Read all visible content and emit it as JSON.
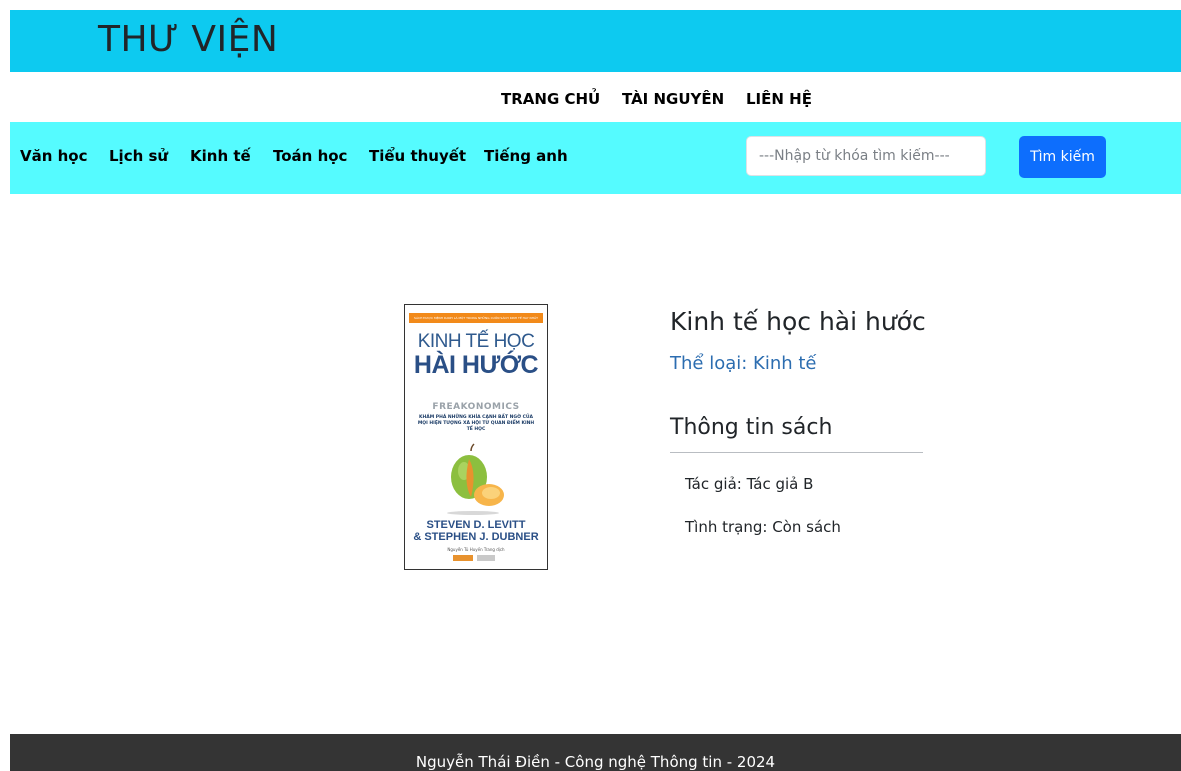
{
  "header": {
    "title": "THƯ VIỆN"
  },
  "topnav": {
    "home": "TRANG CHỦ",
    "resources": "TÀI NGUYÊN",
    "contact": "LIÊN HỆ"
  },
  "categories": [
    "Văn học",
    "Lịch sử",
    "Kinh tế",
    "Toán học",
    "Tiểu thuyết",
    "Tiếng anh"
  ],
  "search": {
    "placeholder": "---Nhập từ khóa tìm kiếm---",
    "value": "",
    "button_label": "Tìm kiếm"
  },
  "book": {
    "cover": {
      "banner": "SÁCH ĐƯỢC MỆNH DANH LÀ MỘT TRONG NHỮNG CUỐN SÁCH KINH TẾ HAY NHẤT",
      "title_line1": "KINH TẾ HỌC",
      "title_line2": "HÀI HƯỚC",
      "subtitle": "FREAKONOMICS",
      "tagline": "KHÁM PHÁ NHỮNG KHÍA CẠNH BẤT NGỜ CỦA MỌI HIỆN TƯỢNG XÃ HỘI TỪ QUAN ĐIỂM KINH TẾ HỌC",
      "author1": "STEVEN D. LEVITT",
      "author2": "& STEPHEN J. DUBNER",
      "translator": "Nguyễn Tú Huyền Trang dịch"
    },
    "title": "Kinh tế học hài hước",
    "category": "Thể loại: Kinh tế",
    "info_heading": "Thông tin sách",
    "author": "Tác giả: Tác giả B",
    "status": "Tình trạng: Còn sách"
  },
  "footer": {
    "text": "Nguyễn Thái Điền - Công nghệ Thông tin - 2024"
  },
  "colors": {
    "header_bg": "#0dcaf0",
    "category_bar_bg": "#55fbff",
    "button_bg": "#0d6efd",
    "category_text": "#2c6db0",
    "footer_bg": "#343434"
  }
}
